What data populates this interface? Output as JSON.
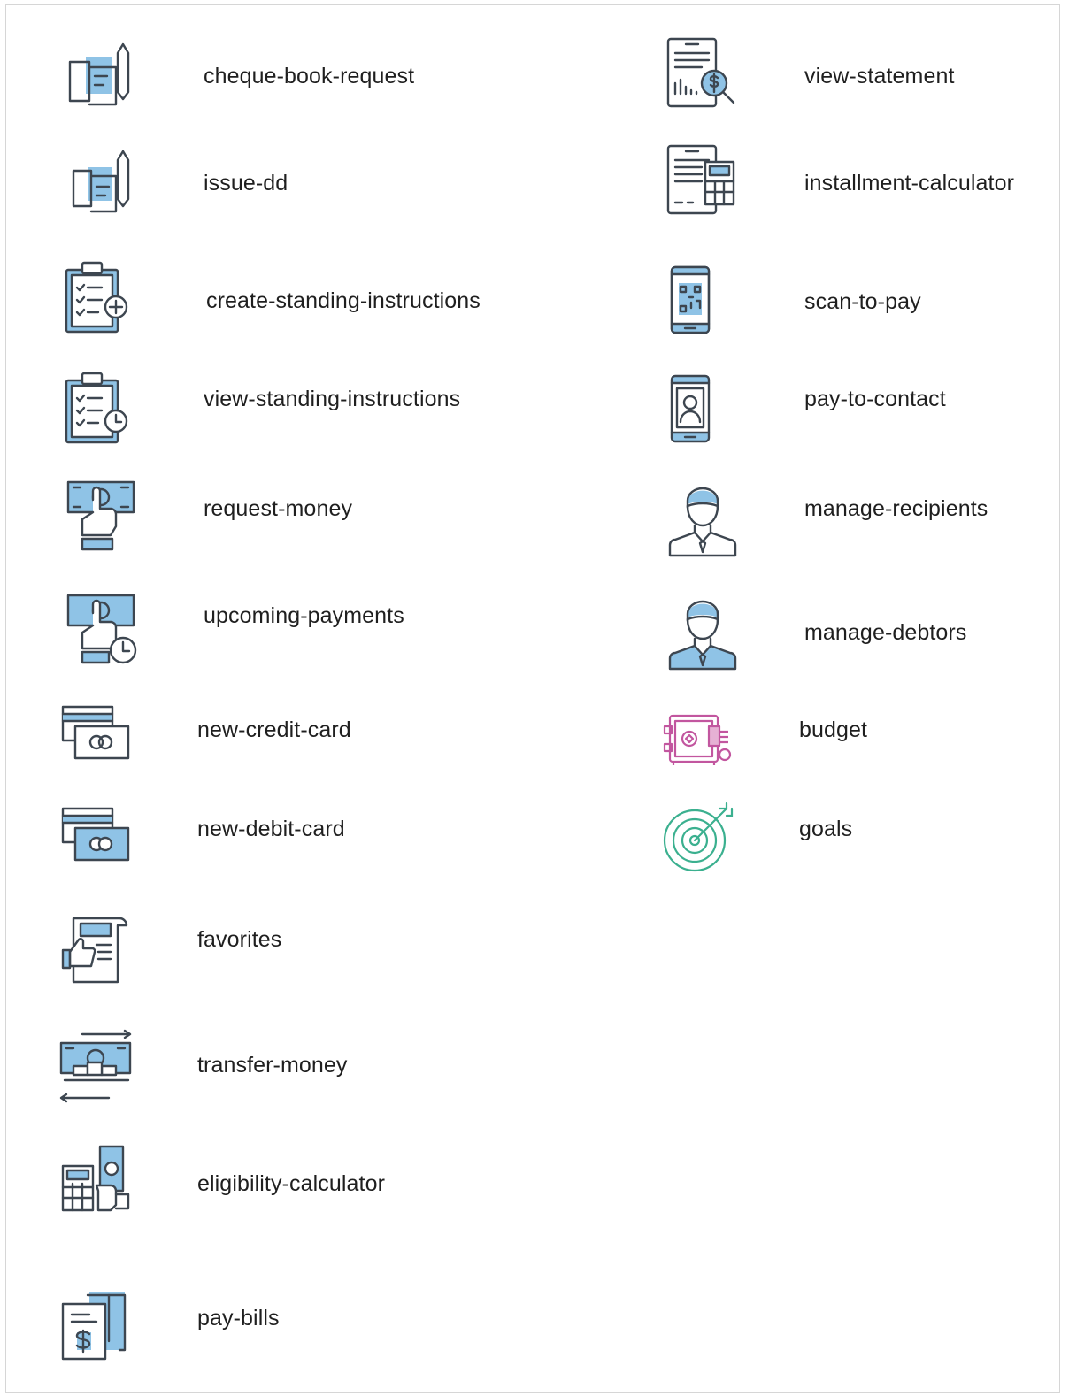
{
  "colors": {
    "outline": "#3d4650",
    "accent_blue": "#8fc3e6",
    "budget_pink": "#c2569f",
    "goals_green": "#3bb08f"
  },
  "left_items": [
    {
      "label": "cheque-book-request",
      "icon": "cheque-book-icon"
    },
    {
      "label": "issue-dd",
      "icon": "demand-draft-icon"
    },
    {
      "label": "create-standing-instructions",
      "icon": "clipboard-plus-icon"
    },
    {
      "label": "view-standing-instructions",
      "icon": "clipboard-clock-icon"
    },
    {
      "label": "request-money",
      "icon": "hand-cash-icon"
    },
    {
      "label": "upcoming-payments",
      "icon": "hand-cash-clock-icon"
    },
    {
      "label": "new-credit-card",
      "icon": "credit-card-icon"
    },
    {
      "label": "new-debit-card",
      "icon": "debit-card-icon"
    },
    {
      "label": "favorites",
      "icon": "thumbs-up-receipt-icon"
    },
    {
      "label": "transfer-money",
      "icon": "transfer-arrows-icon"
    },
    {
      "label": "eligibility-calculator",
      "icon": "calculator-cash-icon"
    },
    {
      "label": "pay-bills",
      "icon": "bill-dollar-icon"
    }
  ],
  "right_items": [
    {
      "label": "view-statement",
      "icon": "statement-magnifier-icon"
    },
    {
      "label": "installment-calculator",
      "icon": "document-calculator-icon"
    },
    {
      "label": "scan-to-pay",
      "icon": "phone-qr-icon"
    },
    {
      "label": "pay-to-contact",
      "icon": "phone-contact-icon"
    },
    {
      "label": "manage-recipients",
      "icon": "person-outline-icon"
    },
    {
      "label": "manage-debtors",
      "icon": "person-filled-icon"
    },
    {
      "label": "budget",
      "icon": "safe-icon"
    },
    {
      "label": "goals",
      "icon": "target-icon"
    }
  ]
}
